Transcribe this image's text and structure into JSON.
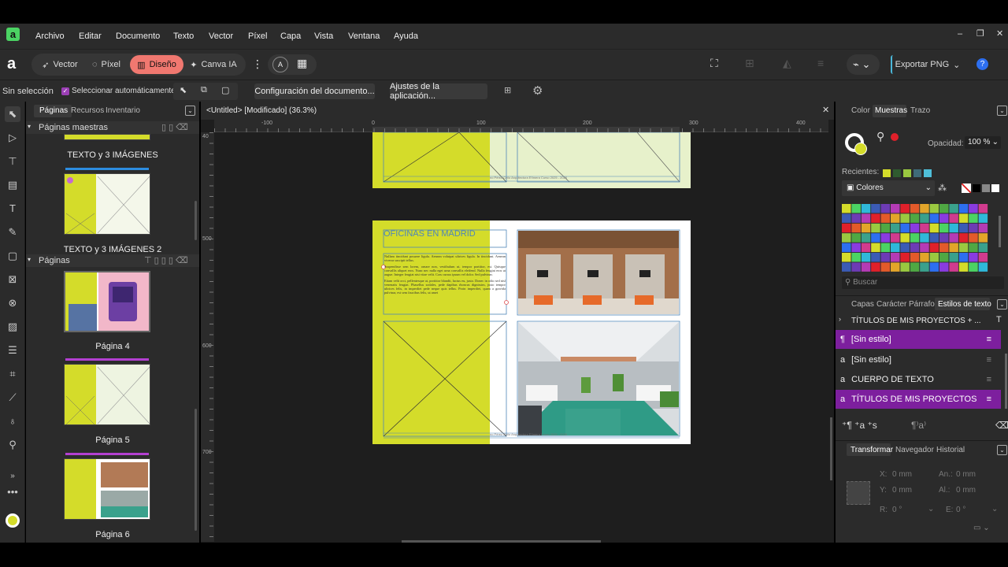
{
  "menu": [
    "Archivo",
    "Editar",
    "Documento",
    "Texto",
    "Vector",
    "Píxel",
    "Capa",
    "Vista",
    "Ventana",
    "Ayuda"
  ],
  "personas": {
    "vector": "Vector",
    "pixel": "Píxel",
    "design": "Diseño",
    "canva": "Canva IA"
  },
  "export_label": "Exportar PNG",
  "context": {
    "selection": "Sin selección",
    "autoselect": "Seleccionar automáticamente:",
    "doc_setup": "Configuración del documento...",
    "app_settings": "Ajustes de la aplicación..."
  },
  "left_tabs": [
    "Páginas",
    "Recursos",
    "Inventario"
  ],
  "master_section": "Páginas maestras",
  "masters": [
    "TEXTO y 3 IMÁGENES",
    "TEXTO y 3 IMÁGENES 2"
  ],
  "pages_section": "Páginas",
  "pages": [
    "Página 4",
    "Página 5",
    "Página 6"
  ],
  "doc_tab": "<Untitled> [Modificado] (36.3%)",
  "ruler_h": [
    "-100",
    "0",
    "100",
    "200",
    "300",
    "400"
  ],
  "ruler_v": [
    "40",
    "500",
    "600",
    "700"
  ],
  "page": {
    "title": "OFICINAS EN MADRID",
    "p1": "Nullam tincidunt posuere ligula. Aenean volutpat ultrices ligula. In tincidunt. Aenean viverra suscipit tellus.",
    "p2": "Suspendisse sem lorem, ornare non, vestibulum ut, tempor porttitor, est. Quisque convallis aliquet eros. Nunc nec nulla eget urna convallis eleifend. Nulla feugiat eros ut augue. Integer feugiat nisi vitae velit. Cras cursus ipsum vel dolor. Sed pulvinar.",
    "p3": "Etiam velit orci, pellentesque at, porttitor blandit, luctus eu, justo. Donec in odio sed nisl venenatis feugiat. Phasellus sodales, pede dapibus rhoncus dignissim, justo tempor ultrices felis, in imperdiet pede neque quis tellus. Proin imperdiet, quam a gravida pulvinar, est sem faucibus felis, ut amet",
    "footer": "no Pérez    Cirilo Arquitectura Efímera    Curso 2025 - 2026"
  },
  "right_tabs": [
    "Color",
    "Muestras",
    "Trazo"
  ],
  "opacity_label": "Opacidad:",
  "opacity_value": "100 %",
  "recents_label": "Recientes:",
  "palette_name": "Colores",
  "search_placeholder": "Buscar",
  "style_tabs": [
    "Capas",
    "Carácter",
    "Párrafo",
    "Estilos de texto"
  ],
  "style_group": "TÍTULOS DE MIS PROYECTOS + ...",
  "styles": [
    "[Sin estilo]",
    "[Sin estilo]",
    "CUERPO DE TEXTO",
    "TÍTULOS DE MIS PROYECTOS"
  ],
  "transform_tabs": [
    "Transformar",
    "Navegador",
    "Historial"
  ],
  "transform": {
    "x_label": "X:",
    "x": "0 mm",
    "w_label": "An.:",
    "w": "0 mm",
    "y_label": "Y:",
    "y": "0 mm",
    "h_label": "Al.:",
    "h": "0 mm",
    "r_label": "R:",
    "r": "0 °",
    "s_label": "E:",
    "s": "0 °"
  },
  "colors": {
    "accent": "#d4dc2a",
    "purple": "#7d1f9e",
    "selected": "#f07870"
  }
}
